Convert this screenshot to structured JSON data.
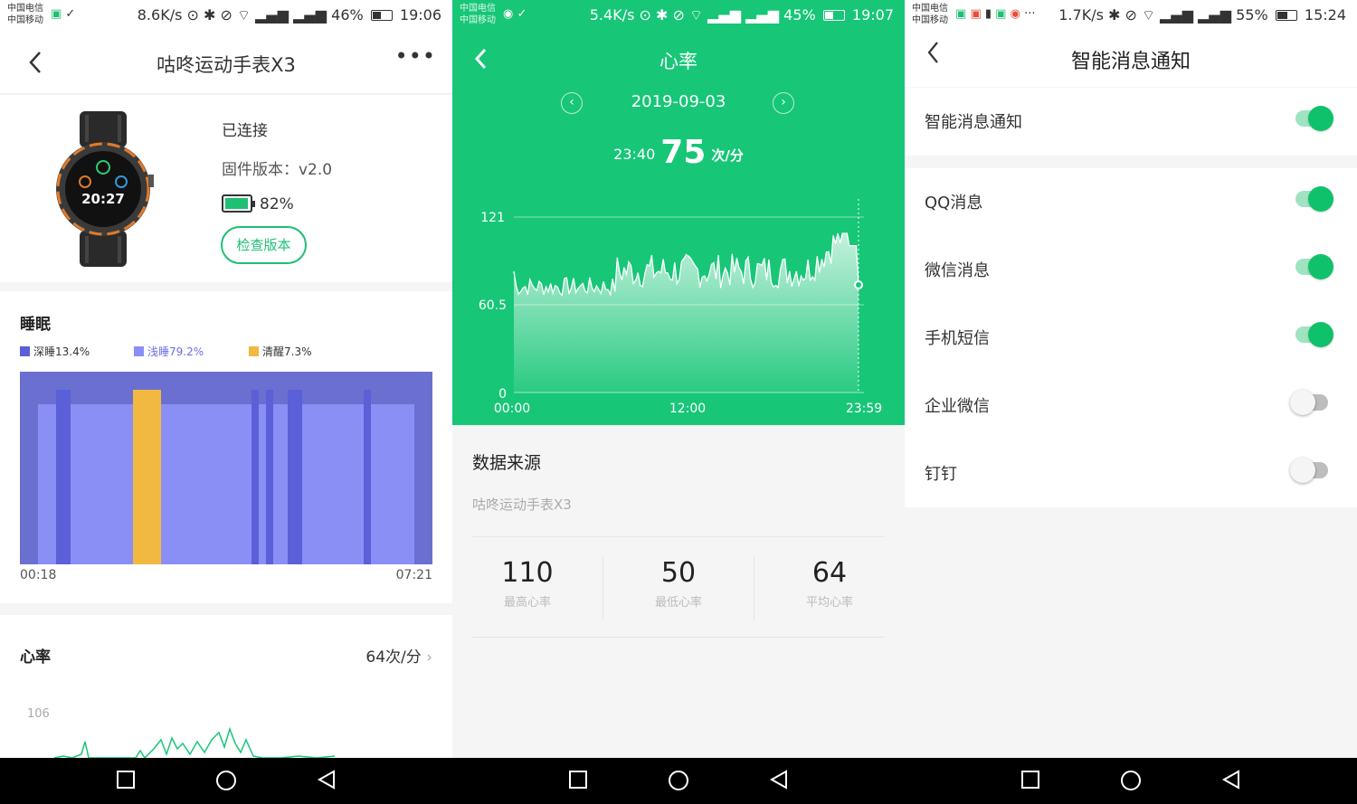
{
  "screen1": {
    "status": {
      "carrier1": "中国电信",
      "carrier2": "中国移动",
      "speed": "8.6K/s",
      "battery": "46%",
      "time": "19:06"
    },
    "title": "咕咚运动手表X3",
    "device": {
      "status": "已连接",
      "firmware": "固件版本：v2.0",
      "battery": "82%",
      "check_button": "检查版本"
    },
    "sleep": {
      "title": "睡眠",
      "legend": [
        {
          "label": "深睡13.4%",
          "color": "#5b5fd8"
        },
        {
          "label": "浅睡79.2%",
          "color": "#8a8ff5"
        },
        {
          "label": "清醒7.3%",
          "color": "#f2b942"
        }
      ],
      "start": "00:18",
      "end": "07:21"
    },
    "heart": {
      "title": "心率",
      "value": "64次/分",
      "axis_max": "106"
    }
  },
  "screen2": {
    "status": {
      "carrier1": "中国电信",
      "carrier2": "中国移动",
      "speed": "5.4K/s",
      "battery": "45%",
      "time": "19:07"
    },
    "title": "心率",
    "date": "2019-09-03",
    "reading": {
      "time": "23:40",
      "value": "75",
      "unit": "次/分"
    },
    "chart_data": {
      "type": "area",
      "title": "",
      "x_ticks": [
        "00:00",
        "12:00",
        "23:59"
      ],
      "y_ticks": [
        "0",
        "60.5",
        "121"
      ],
      "ylim": [
        0,
        121
      ]
    },
    "source": {
      "title": "数据来源",
      "device": "咕咚运动手表X3"
    },
    "stats": [
      {
        "value": "110",
        "label": "最高心率"
      },
      {
        "value": "50",
        "label": "最低心率"
      },
      {
        "value": "64",
        "label": "平均心率"
      }
    ]
  },
  "screen3": {
    "status": {
      "carrier1": "中国电信",
      "carrier2": "中国移动",
      "speed": "1.7K/s",
      "battery": "55%",
      "time": "15:24"
    },
    "title": "智能消息通知",
    "master": {
      "label": "智能消息通知",
      "on": true
    },
    "items": [
      {
        "label": "QQ消息",
        "on": true
      },
      {
        "label": "微信消息",
        "on": true
      },
      {
        "label": "手机短信",
        "on": true
      },
      {
        "label": "企业微信",
        "on": false
      },
      {
        "label": "钉钉",
        "on": false
      }
    ]
  },
  "colors": {
    "brand_green": "#17c677",
    "toggle_on": "#10c16b",
    "deep_sleep": "#5b5fd8",
    "light_sleep": "#8a8ff5",
    "awake": "#f2b942"
  }
}
